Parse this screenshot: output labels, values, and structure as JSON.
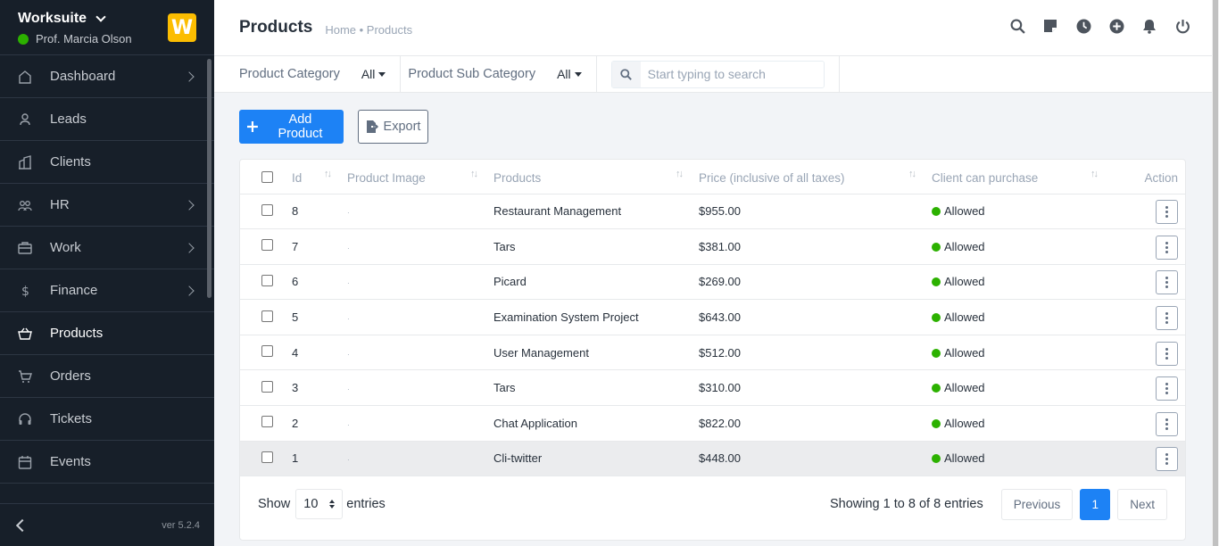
{
  "sidebar": {
    "app_name": "Worksuite",
    "user_name": "Prof. Marcia Olson",
    "logo_letter": "W",
    "items": [
      {
        "label": "Dashboard",
        "icon": "house-icon",
        "arrow": true
      },
      {
        "label": "Leads",
        "icon": "person-icon",
        "arrow": false
      },
      {
        "label": "Clients",
        "icon": "building-icon",
        "arrow": false
      },
      {
        "label": "HR",
        "icon": "people-icon",
        "arrow": true
      },
      {
        "label": "Work",
        "icon": "briefcase-icon",
        "arrow": true
      },
      {
        "label": "Finance",
        "icon": "dollar-icon",
        "arrow": true
      },
      {
        "label": "Products",
        "icon": "basket-icon",
        "arrow": false,
        "active": true
      },
      {
        "label": "Orders",
        "icon": "cart-icon",
        "arrow": false
      },
      {
        "label": "Tickets",
        "icon": "headset-icon",
        "arrow": false
      },
      {
        "label": "Events",
        "icon": "calendar-icon",
        "arrow": false
      }
    ],
    "version": "ver 5.2.4"
  },
  "header": {
    "title": "Products",
    "breadcrumb": "Home • Products",
    "icons": [
      "search-icon",
      "sticky-note-icon",
      "clock-icon",
      "plus-circle-icon",
      "bell-icon",
      "power-icon"
    ]
  },
  "filters": {
    "category_label": "Product Category",
    "category_value": "All",
    "subcategory_label": "Product Sub Category",
    "subcategory_value": "All",
    "search_placeholder": "Start typing to search"
  },
  "actions": {
    "add_label": "Add Product",
    "export_label": "Export"
  },
  "table": {
    "columns": [
      "Id",
      "Product Image",
      "Products",
      "Price (inclusive of all taxes)",
      "Client can purchase",
      "Action"
    ],
    "rows": [
      {
        "id": "8",
        "image": "·",
        "product": "Restaurant Management",
        "price": "$955.00",
        "status": "Allowed"
      },
      {
        "id": "7",
        "image": "·",
        "product": "Tars",
        "price": "$381.00",
        "status": "Allowed"
      },
      {
        "id": "6",
        "image": "·",
        "product": "Picard",
        "price": "$269.00",
        "status": "Allowed"
      },
      {
        "id": "5",
        "image": "·",
        "product": "Examination System Project",
        "price": "$643.00",
        "status": "Allowed"
      },
      {
        "id": "4",
        "image": "·",
        "product": "User Management",
        "price": "$512.00",
        "status": "Allowed"
      },
      {
        "id": "3",
        "image": "·",
        "product": "Tars",
        "price": "$310.00",
        "status": "Allowed"
      },
      {
        "id": "2",
        "image": "·",
        "product": "Chat Application",
        "price": "$822.00",
        "status": "Allowed"
      },
      {
        "id": "1",
        "image": "·",
        "product": "Cli-twitter",
        "price": "$448.00",
        "status": "Allowed"
      }
    ],
    "status_color": "#2cb100"
  },
  "footer": {
    "show_label": "Show",
    "page_length": "10",
    "entries_label": "entries",
    "info": "Showing 1 to 8 of 8 entries",
    "previous": "Previous",
    "current_page": "1",
    "next": "Next"
  },
  "colors": {
    "primary": "#1d82f5",
    "sidebar_bg": "#171f29",
    "logo_bg": "#fcbd01"
  }
}
